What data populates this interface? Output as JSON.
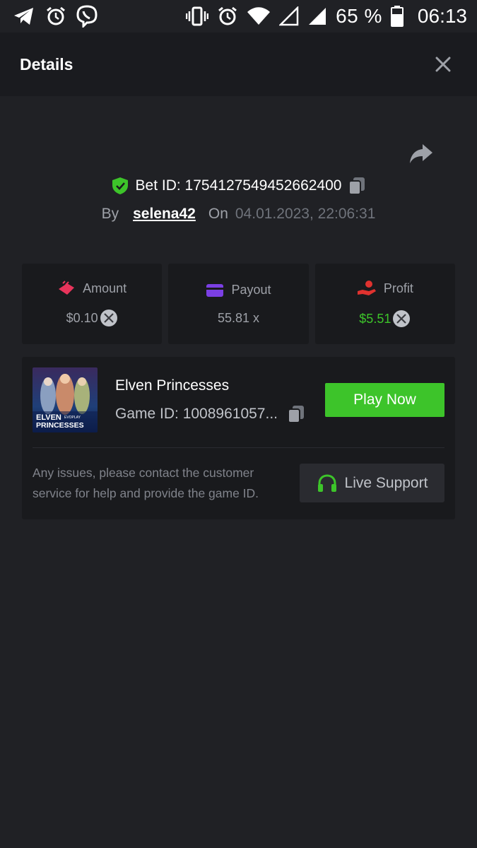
{
  "status_bar": {
    "battery": "65 %",
    "time": "06:13",
    "icons": [
      "telegram-icon",
      "alarm-icon",
      "viber-icon",
      "vibrate-icon",
      "alarm-icon",
      "wifi-icon",
      "signal-icon",
      "signal-icon",
      "battery-icon"
    ]
  },
  "header": {
    "title": "Details"
  },
  "bet": {
    "id_label": "Bet ID: 1754127549452662400",
    "by_label": "By",
    "user": "selena42",
    "on_label": "On",
    "date": "04.01.2023, 22:06:31"
  },
  "stats": [
    {
      "label": "Amount",
      "value": "$0.10",
      "icon": "amount-icon",
      "accent": "#e8345b",
      "coin": true
    },
    {
      "label": "Payout",
      "value": "55.81 x",
      "icon": "payout-icon",
      "accent": "#7b3fe4",
      "coin": false
    },
    {
      "label": "Profit",
      "value": "$5.51",
      "icon": "profit-icon",
      "accent": "#e0322f",
      "coin": true
    }
  ],
  "game": {
    "name": "Elven Princesses",
    "id": "Game ID: 1008961057...",
    "thumb_title_1": "ELVEN",
    "thumb_title_2": "PRINCESSES",
    "thumb_brand": "EVOPLAY",
    "play_label": "Play Now",
    "issues_text": "Any issues, please contact the customer service for help and provide the game ID.",
    "support_label": "Live Support"
  },
  "colors": {
    "background": "#202125",
    "card": "#191a1d",
    "accent_green": "#3dc42a"
  }
}
